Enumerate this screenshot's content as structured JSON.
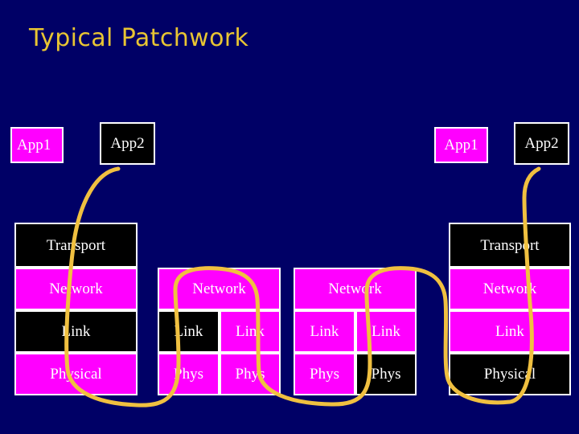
{
  "slide": {
    "title": "Typical Patchwork",
    "background_color": "#000066",
    "title_color": "#E8C533",
    "box_border_color": "#FFFFFF",
    "box_text_color": "#FFFFFF",
    "magenta_color": "#FF00FF",
    "black_color": "#000000",
    "wire_color": "#F0C040"
  },
  "left_host": {
    "app1": "App1",
    "app2": "App2",
    "transport": "Transport",
    "network": "Network",
    "link": "Link",
    "physical": "Physical"
  },
  "router1": {
    "network": "Network",
    "link_left": "Link",
    "link_right": "Link",
    "phys_left": "Phys",
    "phys_right": "Phys"
  },
  "router2": {
    "network": "Network",
    "link_left": "Link",
    "link_right": "Link",
    "phys_left": "Phys",
    "phys_right": "Phys"
  },
  "right_host": {
    "app1": "App1",
    "app2": "App2",
    "transport": "Transport",
    "network": "Network",
    "link": "Link",
    "physical": "Physical"
  }
}
